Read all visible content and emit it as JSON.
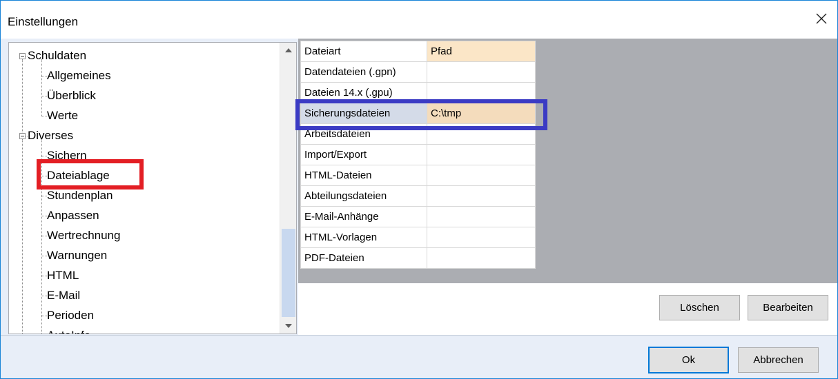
{
  "window": {
    "title": "Einstellungen"
  },
  "tree": {
    "items": [
      {
        "label": "Schuldaten",
        "level": 0,
        "expanded": true
      },
      {
        "label": "Allgemeines",
        "level": 1
      },
      {
        "label": "Überblick",
        "level": 1
      },
      {
        "label": "Werte",
        "level": 1
      },
      {
        "label": "Diverses",
        "level": 0,
        "expanded": true
      },
      {
        "label": "Sichern",
        "level": 1
      },
      {
        "label": "Dateiablage",
        "level": 1,
        "selected": true
      },
      {
        "label": "Stundenplan",
        "level": 1
      },
      {
        "label": "Anpassen",
        "level": 1
      },
      {
        "label": "Wertrechnung",
        "level": 1
      },
      {
        "label": "Warnungen",
        "level": 1
      },
      {
        "label": "HTML",
        "level": 1
      },
      {
        "label": "E-Mail",
        "level": 1
      },
      {
        "label": "Perioden",
        "level": 1
      },
      {
        "label": "AutoInfo",
        "level": 1
      }
    ]
  },
  "grid": {
    "headers": {
      "type": "Dateiart",
      "path": "Pfad"
    },
    "rows": [
      {
        "type": "Datendateien (.gpn)",
        "path": ""
      },
      {
        "type": "Dateien 14.x (.gpu)",
        "path": ""
      },
      {
        "type": "Sicherungsdateien",
        "path": "C:\\tmp",
        "selected": true
      },
      {
        "type": "Arbeitsdateien",
        "path": ""
      },
      {
        "type": "Import/Export",
        "path": ""
      },
      {
        "type": "HTML-Dateien",
        "path": ""
      },
      {
        "type": "Abteilungsdateien",
        "path": ""
      },
      {
        "type": "E-Mail-Anhänge",
        "path": ""
      },
      {
        "type": "HTML-Vorlagen",
        "path": ""
      },
      {
        "type": "PDF-Dateien",
        "path": ""
      }
    ]
  },
  "buttons": {
    "delete": "Löschen",
    "edit": "Bearbeiten",
    "ok": "Ok",
    "cancel": "Abbrechen"
  },
  "colors": {
    "accent": "#0078d7",
    "highlight_red": "#e31e24",
    "highlight_blue": "#3b3bc4",
    "path_header": "#fbe6c7"
  }
}
